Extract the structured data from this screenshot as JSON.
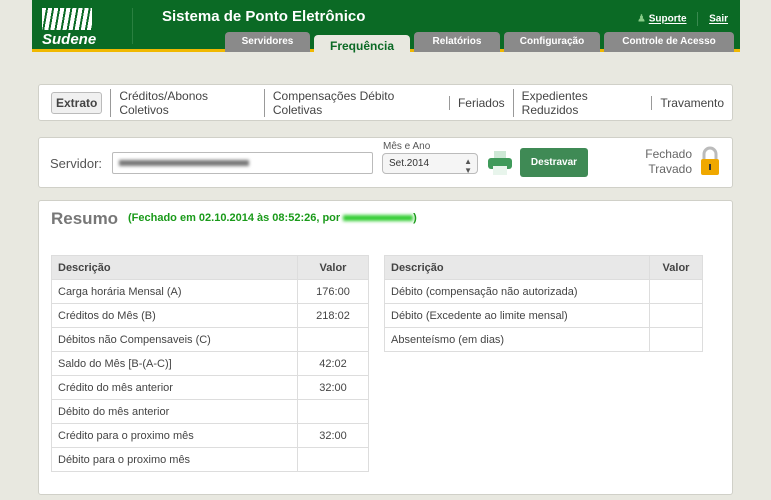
{
  "header": {
    "logo": "Sudene",
    "title": "Sistema de Ponto Eletrônico",
    "support": "Suporte",
    "logout": "Sair"
  },
  "tabs": [
    {
      "label": "Servidores"
    },
    {
      "label": "Frequência"
    },
    {
      "label": "Relatórios"
    },
    {
      "label": "Configuração"
    },
    {
      "label": "Controle de Acesso"
    }
  ],
  "subnav": [
    "Extrato",
    "Créditos/Abonos Coletivos",
    "Compensações Débito Coletivas",
    "Feriados",
    "Expedientes Reduzidos",
    "Travamento"
  ],
  "filter": {
    "servidor_label": "Servidor:",
    "mes_label": "Mês e Ano",
    "mes_value": "Set.2014",
    "unlock_button": "Destravar",
    "status_line1": "Fechado",
    "status_line2": "Travado"
  },
  "resumo": {
    "title": "Resumo",
    "subtitle": "(Fechado em 02.10.2014 às 08:52:26, por",
    "left": {
      "headers": [
        "Descrição",
        "Valor"
      ],
      "rows": [
        [
          "Carga horária Mensal (A)",
          "176:00"
        ],
        [
          "Créditos do Mês (B)",
          "218:02"
        ],
        [
          "Débitos não Compensaveis (C)",
          ""
        ],
        [
          "Saldo do Mês [B-(A-C)]",
          "42:02"
        ],
        [
          "Crédito do mês anterior",
          "32:00"
        ],
        [
          "Débito do mês anterior",
          ""
        ],
        [
          "Crédito para o proximo mês",
          "32:00"
        ],
        [
          "Débito para o proximo mês",
          ""
        ]
      ]
    },
    "right": {
      "headers": [
        "Descrição",
        "Valor"
      ],
      "rows": [
        [
          "Débito (compensação não autorizada)",
          ""
        ],
        [
          "Débito (Excedente ao limite mensal)",
          ""
        ],
        [
          "Absenteísmo (em dias)",
          ""
        ]
      ]
    }
  }
}
